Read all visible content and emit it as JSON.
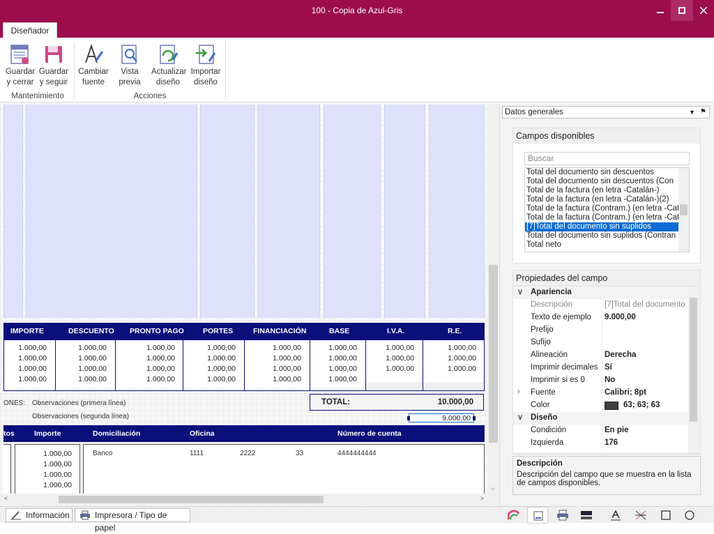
{
  "window": {
    "title": "100 - Copia de Azul-Gris"
  },
  "ribbon": {
    "tab": "Diseñador",
    "buttons": {
      "save_close_1": "Guardar",
      "save_close_2": "y cerrar",
      "save_continue_1": "Guardar",
      "save_continue_2": "y seguir",
      "change_font_1": "Cambiar",
      "change_font_2": "fuente",
      "preview_1": "Vista",
      "preview_2": "previa",
      "update_1": "Actualizar",
      "update_2": "diseño",
      "import_1": "Importar",
      "import_2": "diseño"
    },
    "groups": {
      "maintenance": "Mantenimiento",
      "actions": "Acciones"
    }
  },
  "designer": {
    "totals_headers": [
      "IMPORTE",
      "DESCUENTO",
      "PRONTO PAGO",
      "PORTES",
      "FINANCIACIÓN",
      "BASE",
      "I.V.A.",
      "R.E."
    ],
    "value": "1.000,00",
    "observations_label": "ONES:",
    "obs_line1": "Observaciones (primera línea)",
    "obs_line2": "Observaciones (segunda línea)",
    "total_label": "TOTAL:",
    "total_value": "10.000,00",
    "selected_value": "9.000,00",
    "payment_headers": [
      "tos",
      "Importe",
      "Domiciliación",
      "Oficina",
      "Número de cuenta"
    ],
    "payment_row": {
      "bank": "Banco",
      "office": "1111",
      "office2": "2222",
      "dc": "33",
      "account": "4444444444"
    }
  },
  "panel": {
    "combo": "Datos generales",
    "fields_title": "Campos disponibles",
    "search_placeholder": "Buscar",
    "fields": [
      "Total del documento sin descuentos",
      "Total del documento sin descuentos  (Con",
      "Total de la factura (en letra -Catalán-)",
      "Total de la factura (en letra -Catalán-)(2)",
      "Total de la factura (Contram.) (en letra -Cat",
      "Total de la factura (Contram.) (en letra -Cat",
      "[7]Total del documento sin suplidos",
      "Total del documento sin suplidos (Contran",
      "Total neto"
    ],
    "props_title": "Propiedades del campo",
    "cat_appearance": "Apariencia",
    "cat_design": "Diseño",
    "props": [
      {
        "name": "Descripción",
        "value": "[7]Total del documento"
      },
      {
        "name": "Texto de ejemplo",
        "value": "9.000,00"
      },
      {
        "name": "Prefijo",
        "value": ""
      },
      {
        "name": "Sufijo",
        "value": ""
      },
      {
        "name": "Alineación",
        "value": "Derecha"
      },
      {
        "name": "Imprimir decimales",
        "value": "Sí"
      },
      {
        "name": "Imprimir si es 0",
        "value": "No"
      },
      {
        "name": "Fuente",
        "value": "Calibri; 8pt"
      },
      {
        "name": "Color",
        "value": "63; 63; 63"
      }
    ],
    "design_props": [
      {
        "name": "Condición",
        "value": "En pie"
      },
      {
        "name": "Izquierda",
        "value": "176"
      }
    ],
    "desc_title": "Descripción",
    "desc_text": "Descripción del campo que se muestra en la lista de campos disponibles."
  },
  "status": {
    "info_tab": "Información",
    "printer_tab": "Impresora / Tipo de papel"
  },
  "colors": {
    "brand": "#9b0d4b",
    "header_blue": "#0b0f7a",
    "band": "#dfe1fb",
    "selection": "#0b6cd4",
    "swatch": "#3f3f3f"
  }
}
